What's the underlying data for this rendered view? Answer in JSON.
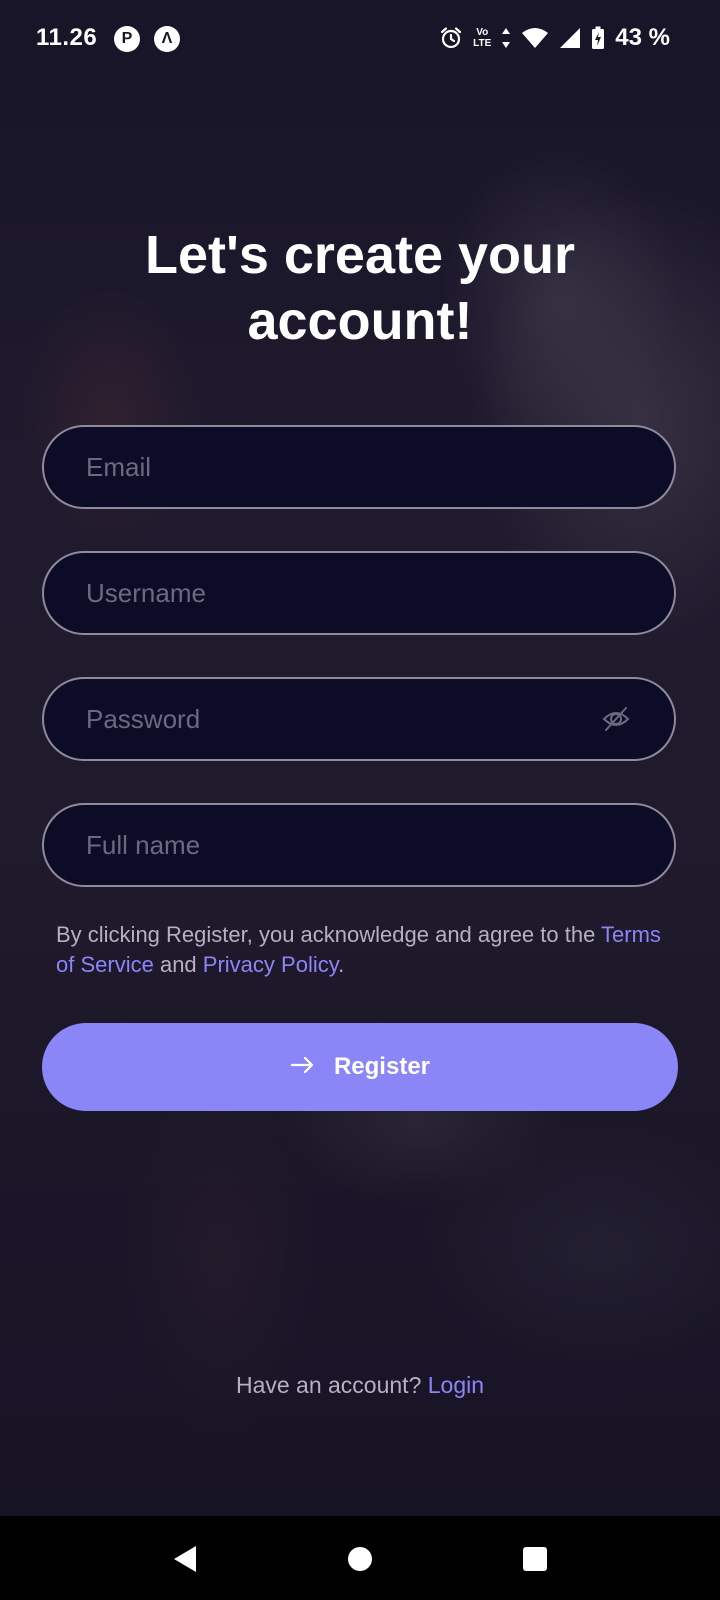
{
  "status_bar": {
    "time": "11.26",
    "app_icon_1": "P",
    "app_icon_2": "Λ",
    "volte_line1": "Vo",
    "volte_line2": "LTE",
    "battery_percent": "43 %"
  },
  "page": {
    "title": "Let's create your account!"
  },
  "form": {
    "email_placeholder": "Email",
    "username_placeholder": "Username",
    "password_placeholder": "Password",
    "fullname_placeholder": "Full name",
    "password_toggle_icon": "eye-off-icon"
  },
  "legal": {
    "prefix": "By clicking Register, you acknowledge and agree to the",
    "terms_link": "Terms of Service",
    "and": "and",
    "privacy_link": "Privacy Policy",
    "suffix": "."
  },
  "register": {
    "label": "Register",
    "icon": "arrow-right-icon"
  },
  "login_prompt": {
    "text": "Have an account?",
    "link": "Login"
  },
  "theme": {
    "accent": "#8b86f7",
    "field_background": "#0d0c27",
    "field_border": "#8e8a9c"
  }
}
